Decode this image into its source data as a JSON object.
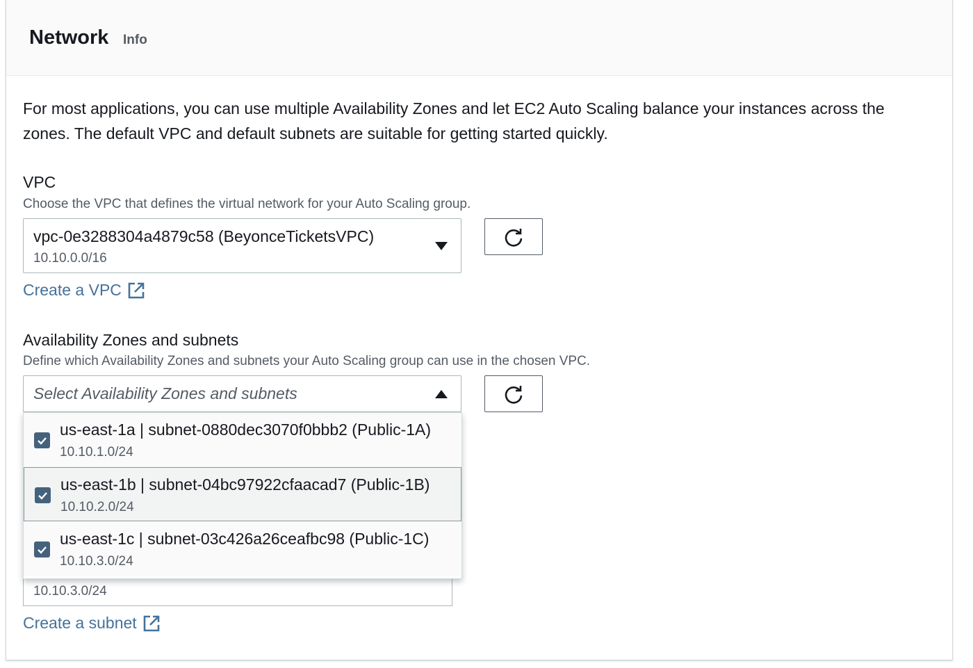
{
  "header": {
    "title": "Network",
    "info": "Info"
  },
  "description": "For most applications, you can use multiple Availability Zones and let EC2 Auto Scaling balance your instances across the zones. The default VPC and default subnets are suitable for getting started quickly.",
  "vpc": {
    "label": "VPC",
    "description": "Choose the VPC that defines the virtual network for your Auto Scaling group.",
    "selected": "vpc-0e3288304a4879c58 (BeyonceTicketsVPC)",
    "cidr": "10.10.0.0/16",
    "create_link": "Create a VPC"
  },
  "subnets": {
    "label": "Availability Zones and subnets",
    "description": "Define which Availability Zones and subnets your Auto Scaling group can use in the chosen VPC.",
    "placeholder": "Select Availability Zones and subnets",
    "options": [
      {
        "label": "us-east-1a | subnet-0880dec3070f0bbb2 (Public-1A)",
        "cidr": "10.10.1.0/24",
        "checked": true
      },
      {
        "label": "us-east-1b | subnet-04bc97922cfaacad7 (Public-1B)",
        "cidr": "10.10.2.0/24",
        "checked": true
      },
      {
        "label": "us-east-1c | subnet-03c426a26ceafbc98 (Public-1C)",
        "cidr": "10.10.3.0/24",
        "checked": true
      }
    ],
    "behind_cidr": "10.10.3.0/24",
    "create_link": "Create a subnet"
  },
  "colors": {
    "link": "#44729b",
    "checkbox": "#44627c",
    "border": "#aab7b8"
  }
}
